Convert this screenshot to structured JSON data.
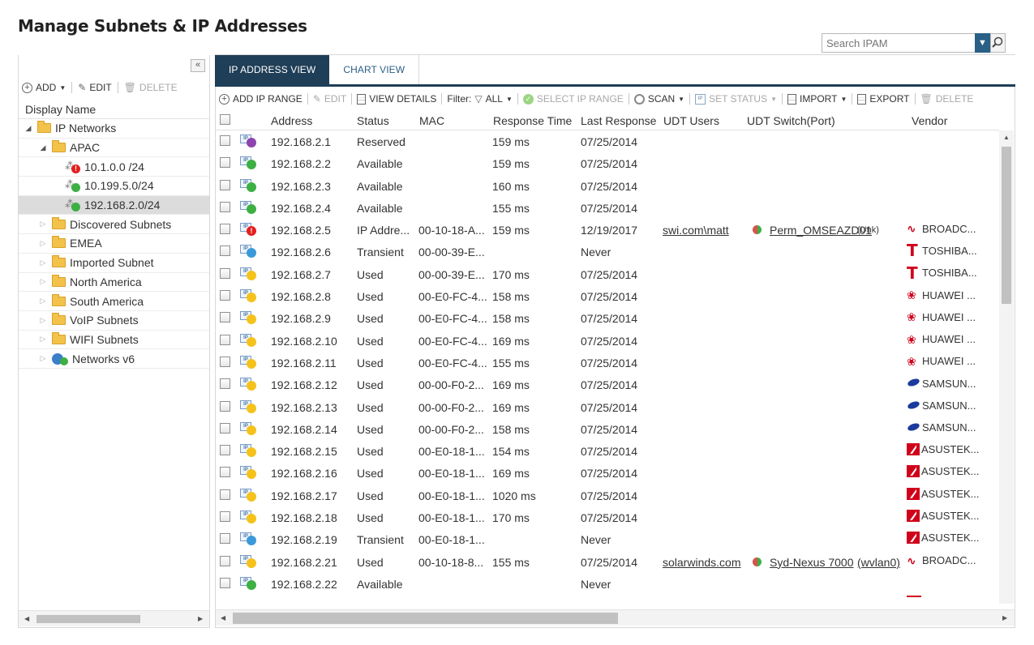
{
  "page": {
    "title": "Manage Subnets & IP Addresses"
  },
  "search": {
    "placeholder": "Search IPAM"
  },
  "left": {
    "toolbar": {
      "add": "ADD",
      "edit": "EDIT",
      "delete": "DELETE"
    },
    "display_name": "Display Name",
    "tree": [
      {
        "label": "IP Networks",
        "level": 0,
        "expanded": true,
        "icon": "folder-icon"
      },
      {
        "label": "APAC",
        "level": 1,
        "expanded": true,
        "icon": "folder-icon"
      },
      {
        "label": "10.1.0.0 /24",
        "level": 2,
        "icon": "subnet-icon",
        "status": "#e41e1e"
      },
      {
        "label": "10.199.5.0/24",
        "level": 2,
        "icon": "subnet-icon",
        "status": "#3cb043"
      },
      {
        "label": "192.168.2.0/24",
        "level": 2,
        "icon": "subnet-icon",
        "status": "#3cb043",
        "selected": true
      },
      {
        "label": "Discovered Subnets",
        "level": 1,
        "expanded": false,
        "icon": "folder-icon"
      },
      {
        "label": "EMEA",
        "level": 1,
        "expanded": false,
        "icon": "folder-icon"
      },
      {
        "label": "Imported Subnet",
        "level": 1,
        "expanded": false,
        "icon": "folder-icon"
      },
      {
        "label": "North America",
        "level": 1,
        "expanded": false,
        "icon": "folder-icon"
      },
      {
        "label": "South America",
        "level": 1,
        "expanded": false,
        "icon": "folder-icon"
      },
      {
        "label": "VoIP Subnets",
        "level": 1,
        "expanded": false,
        "icon": "folder-icon"
      },
      {
        "label": "WIFI Subnets",
        "level": 1,
        "expanded": false,
        "icon": "folder-icon"
      },
      {
        "label": "Networks v6",
        "level": 1,
        "expanded": false,
        "icon": "globe-icon"
      }
    ]
  },
  "tabs": [
    {
      "label": "IP ADDRESS VIEW",
      "active": true
    },
    {
      "label": "CHART VIEW",
      "active": false
    }
  ],
  "toolbar": {
    "add_ip_range": "ADD IP RANGE",
    "edit": "EDIT",
    "view_details": "VIEW DETAILS",
    "filter_label": "Filter:",
    "filter_value": "ALL",
    "select_ip_range": "SELECT IP RANGE",
    "scan": "SCAN",
    "set_status": "SET STATUS",
    "import": "IMPORT",
    "export": "EXPORT",
    "delete": "DELETE"
  },
  "columns": [
    "Address",
    "Status",
    "MAC",
    "Response Time",
    "Last Response",
    "UDT Users",
    "UDT Switch(Port)",
    "Vendor"
  ],
  "status_colors": {
    "Reserved": "#8e44ad",
    "Available": "#3cb043",
    "IP Address Conflict": "#e41e1e",
    "Transient": "#3a9ad9",
    "Used": "#f5c21b"
  },
  "rows": [
    {
      "address": "192.168.2.1",
      "status": "Reserved",
      "status_key": "Reserved",
      "mac": "",
      "response": "159 ms",
      "last": "07/25/2014",
      "user": "",
      "switch": "",
      "port": "",
      "vendor": "",
      "vendor_logo": ""
    },
    {
      "address": "192.168.2.2",
      "status": "Available",
      "status_key": "Available",
      "mac": "",
      "response": "159 ms",
      "last": "07/25/2014",
      "user": "",
      "switch": "",
      "port": "",
      "vendor": "",
      "vendor_logo": ""
    },
    {
      "address": "192.168.2.3",
      "status": "Available",
      "status_key": "Available",
      "mac": "",
      "response": "160 ms",
      "last": "07/25/2014",
      "user": "",
      "switch": "",
      "port": "",
      "vendor": "",
      "vendor_logo": ""
    },
    {
      "address": "192.168.2.4",
      "status": "Available",
      "status_key": "Available",
      "mac": "",
      "response": "155 ms",
      "last": "07/25/2014",
      "user": "",
      "switch": "",
      "port": "",
      "vendor": "",
      "vendor_logo": ""
    },
    {
      "address": "192.168.2.5",
      "status": "IP Addre...",
      "status_key": "IP Address Conflict",
      "mac": "00-10-18-A...",
      "response": "159 ms",
      "last": "12/19/2017",
      "user": "swi.com\\matt",
      "switch": "Perm_OMSEAZD01",
      "port": "(Unk)",
      "vendor": "BROADC...",
      "vendor_logo": "broadcom"
    },
    {
      "address": "192.168.2.6",
      "status": "Transient",
      "status_key": "Transient",
      "mac": "00-00-39-E...",
      "response": "",
      "last": "Never",
      "user": "",
      "switch": "",
      "port": "",
      "vendor": "TOSHIBA...",
      "vendor_logo": "toshiba"
    },
    {
      "address": "192.168.2.7",
      "status": "Used",
      "status_key": "Used",
      "mac": "00-00-39-E...",
      "response": "170 ms",
      "last": "07/25/2014",
      "user": "",
      "switch": "",
      "port": "",
      "vendor": "TOSHIBA...",
      "vendor_logo": "toshiba"
    },
    {
      "address": "192.168.2.8",
      "status": "Used",
      "status_key": "Used",
      "mac": "00-E0-FC-4...",
      "response": "158 ms",
      "last": "07/25/2014",
      "user": "",
      "switch": "",
      "port": "",
      "vendor": "HUAWEI ...",
      "vendor_logo": "huawei"
    },
    {
      "address": "192.168.2.9",
      "status": "Used",
      "status_key": "Used",
      "mac": "00-E0-FC-4...",
      "response": "158 ms",
      "last": "07/25/2014",
      "user": "",
      "switch": "",
      "port": "",
      "vendor": "HUAWEI ...",
      "vendor_logo": "huawei"
    },
    {
      "address": "192.168.2.10",
      "status": "Used",
      "status_key": "Used",
      "mac": "00-E0-FC-4...",
      "response": "169 ms",
      "last": "07/25/2014",
      "user": "",
      "switch": "",
      "port": "",
      "vendor": "HUAWEI ...",
      "vendor_logo": "huawei"
    },
    {
      "address": "192.168.2.11",
      "status": "Used",
      "status_key": "Used",
      "mac": "00-E0-FC-4...",
      "response": "155 ms",
      "last": "07/25/2014",
      "user": "",
      "switch": "",
      "port": "",
      "vendor": "HUAWEI ...",
      "vendor_logo": "huawei"
    },
    {
      "address": "192.168.2.12",
      "status": "Used",
      "status_key": "Used",
      "mac": "00-00-F0-2...",
      "response": "169 ms",
      "last": "07/25/2014",
      "user": "",
      "switch": "",
      "port": "",
      "vendor": "SAMSUN...",
      "vendor_logo": "samsung"
    },
    {
      "address": "192.168.2.13",
      "status": "Used",
      "status_key": "Used",
      "mac": "00-00-F0-2...",
      "response": "169 ms",
      "last": "07/25/2014",
      "user": "",
      "switch": "",
      "port": "",
      "vendor": "SAMSUN...",
      "vendor_logo": "samsung"
    },
    {
      "address": "192.168.2.14",
      "status": "Used",
      "status_key": "Used",
      "mac": "00-00-F0-2...",
      "response": "158 ms",
      "last": "07/25/2014",
      "user": "",
      "switch": "",
      "port": "",
      "vendor": "SAMSUN...",
      "vendor_logo": "samsung"
    },
    {
      "address": "192.168.2.15",
      "status": "Used",
      "status_key": "Used",
      "mac": "00-E0-18-1...",
      "response": "154 ms",
      "last": "07/25/2014",
      "user": "",
      "switch": "",
      "port": "",
      "vendor": "ASUSTEK...",
      "vendor_logo": "asus"
    },
    {
      "address": "192.168.2.16",
      "status": "Used",
      "status_key": "Used",
      "mac": "00-E0-18-1...",
      "response": "169 ms",
      "last": "07/25/2014",
      "user": "",
      "switch": "",
      "port": "",
      "vendor": "ASUSTEK...",
      "vendor_logo": "asus"
    },
    {
      "address": "192.168.2.17",
      "status": "Used",
      "status_key": "Used",
      "mac": "00-E0-18-1...",
      "response": "1020 ms",
      "last": "07/25/2014",
      "user": "",
      "switch": "",
      "port": "",
      "vendor": "ASUSTEK...",
      "vendor_logo": "asus"
    },
    {
      "address": "192.168.2.18",
      "status": "Used",
      "status_key": "Used",
      "mac": "00-E0-18-1...",
      "response": "170 ms",
      "last": "07/25/2014",
      "user": "",
      "switch": "",
      "port": "",
      "vendor": "ASUSTEK...",
      "vendor_logo": "asus"
    },
    {
      "address": "192.168.2.19",
      "status": "Transient",
      "status_key": "Transient",
      "mac": "00-E0-18-1...",
      "response": "",
      "last": "Never",
      "user": "",
      "switch": "",
      "port": "",
      "vendor": "ASUSTEK...",
      "vendor_logo": "asus"
    },
    {
      "address": "192.168.2.21",
      "status": "Used",
      "status_key": "Used",
      "mac": "00-10-18-8...",
      "response": "155 ms",
      "last": "07/25/2014",
      "user": "solarwinds.com",
      "switch": "Syd-Nexus 7000",
      "port": "(wvlan0)",
      "vendor": "BROADC...",
      "vendor_logo": "broadcom"
    },
    {
      "address": "192.168.2.22",
      "status": "Available",
      "status_key": "Available",
      "mac": "",
      "response": "",
      "last": "Never",
      "user": "",
      "switch": "",
      "port": "",
      "vendor": "",
      "vendor_logo": ""
    }
  ]
}
